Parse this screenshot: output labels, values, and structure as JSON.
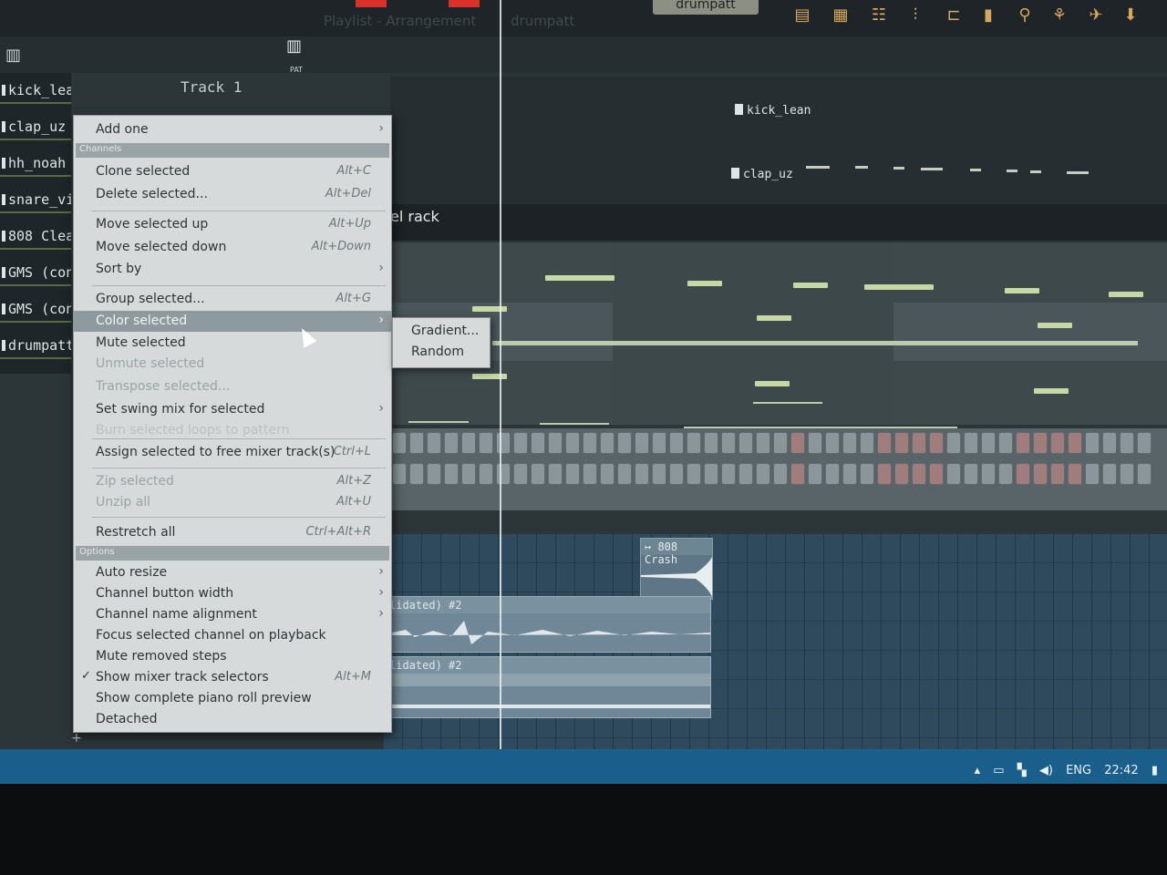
{
  "toolbar": {
    "pattern_selector": "drumpatt",
    "faint_title": "Playlist - Arrangement",
    "faint_pattern": "drumpatt"
  },
  "row2": {
    "pat_label": "PAT"
  },
  "channels": [
    {
      "name": "kick_lean"
    },
    {
      "name": "clap_uz"
    },
    {
      "name": "hh_noah"
    },
    {
      "name": "snare_vi"
    },
    {
      "name": "808 Clea"
    },
    {
      "name": "GMS (con"
    },
    {
      "name": "GMS (con"
    },
    {
      "name": "drumpatt"
    }
  ],
  "track_header": "Track 1",
  "playlist_clips": {
    "kick": "kick_lean",
    "clap": "clap_uz"
  },
  "channel_rack_title": "el rack",
  "menu": {
    "add_one": "Add one",
    "header_channels": "Channels",
    "clone_selected": "Clone selected",
    "clone_shortcut": "Alt+C",
    "delete_selected": "Delete selected...",
    "delete_shortcut": "Alt+Del",
    "move_up": "Move selected up",
    "move_up_shortcut": "Alt+Up",
    "move_down": "Move selected down",
    "move_down_shortcut": "Alt+Down",
    "sort_by": "Sort by",
    "group_selected": "Group selected...",
    "group_shortcut": "Alt+G",
    "color_selected": "Color selected",
    "mute_selected": "Mute selected",
    "unmute_selected": "Unmute selected",
    "transpose_selected": "Transpose selected...",
    "swing_mix": "Set swing mix for selected",
    "burn_loops": "Burn selected loops to pattern",
    "assign_mixer": "Assign selected to free mixer track(s)",
    "assign_shortcut": "Ctrl+L",
    "zip_selected": "Zip selected",
    "zip_shortcut": "Alt+Z",
    "unzip_all": "Unzip all",
    "unzip_shortcut": "Alt+U",
    "restretch_all": "Restretch all",
    "restretch_shortcut": "Ctrl+Alt+R",
    "header_options": "Options",
    "auto_resize": "Auto resize",
    "button_width": "Channel button width",
    "name_alignment": "Channel name alignment",
    "focus_selected": "Focus selected channel on playback",
    "mute_removed": "Mute removed steps",
    "show_mixer": "Show mixer track selectors",
    "show_mixer_shortcut": "Alt+M",
    "show_piano_roll": "Show complete piano roll preview",
    "detached": "Detached"
  },
  "submenu": {
    "gradient": "Gradient...",
    "random": "Random"
  },
  "arrange": {
    "crash_clip": "808 Crash",
    "audio_clip_1": "lidated) #2",
    "audio_clip_2": "lidated) #2"
  },
  "taskbar": {
    "language": "ENG",
    "time": "22:42"
  },
  "colors": {
    "menu_bg": "#d6dadb",
    "menu_highlight": "#8e9a9d",
    "taskbar": "#1a5f8c",
    "note_green": "#c6d8a6",
    "record_red": "#d8322a"
  }
}
